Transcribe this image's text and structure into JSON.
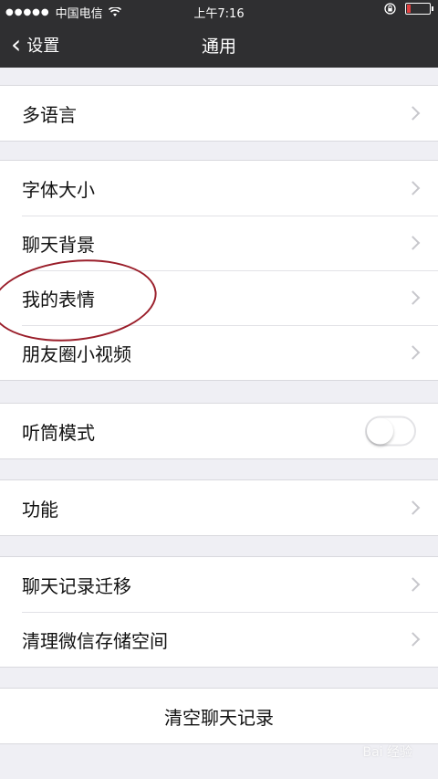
{
  "status_bar": {
    "signal_dots": "●●●●●",
    "carrier": "中国电信",
    "wifi_icon": "wifi-icon",
    "time": "上午7:16",
    "lock_icon": "orientation-lock-icon",
    "battery_level": 0.15,
    "battery_color": "#e04040"
  },
  "nav": {
    "back_label": "设置",
    "title": "通用",
    "bg_color": "#2f2f31"
  },
  "groups": [
    {
      "items": [
        {
          "label": "多语言"
        }
      ]
    },
    {
      "items": [
        {
          "label": "字体大小"
        },
        {
          "label": "聊天背景"
        },
        {
          "label": "我的表情"
        },
        {
          "label": "朋友圈小视频"
        }
      ]
    },
    {
      "items": [
        {
          "label": "听筒模式",
          "toggle": false
        }
      ]
    },
    {
      "items": [
        {
          "label": "功能"
        }
      ]
    },
    {
      "items": [
        {
          "label": "聊天记录迁移"
        },
        {
          "label": "清理微信存储空间"
        }
      ]
    },
    {
      "items": [
        {
          "label": "清空聊天记录"
        }
      ]
    }
  ],
  "annotation_color": "#9a1e2a",
  "watermark": "Bai 经验"
}
